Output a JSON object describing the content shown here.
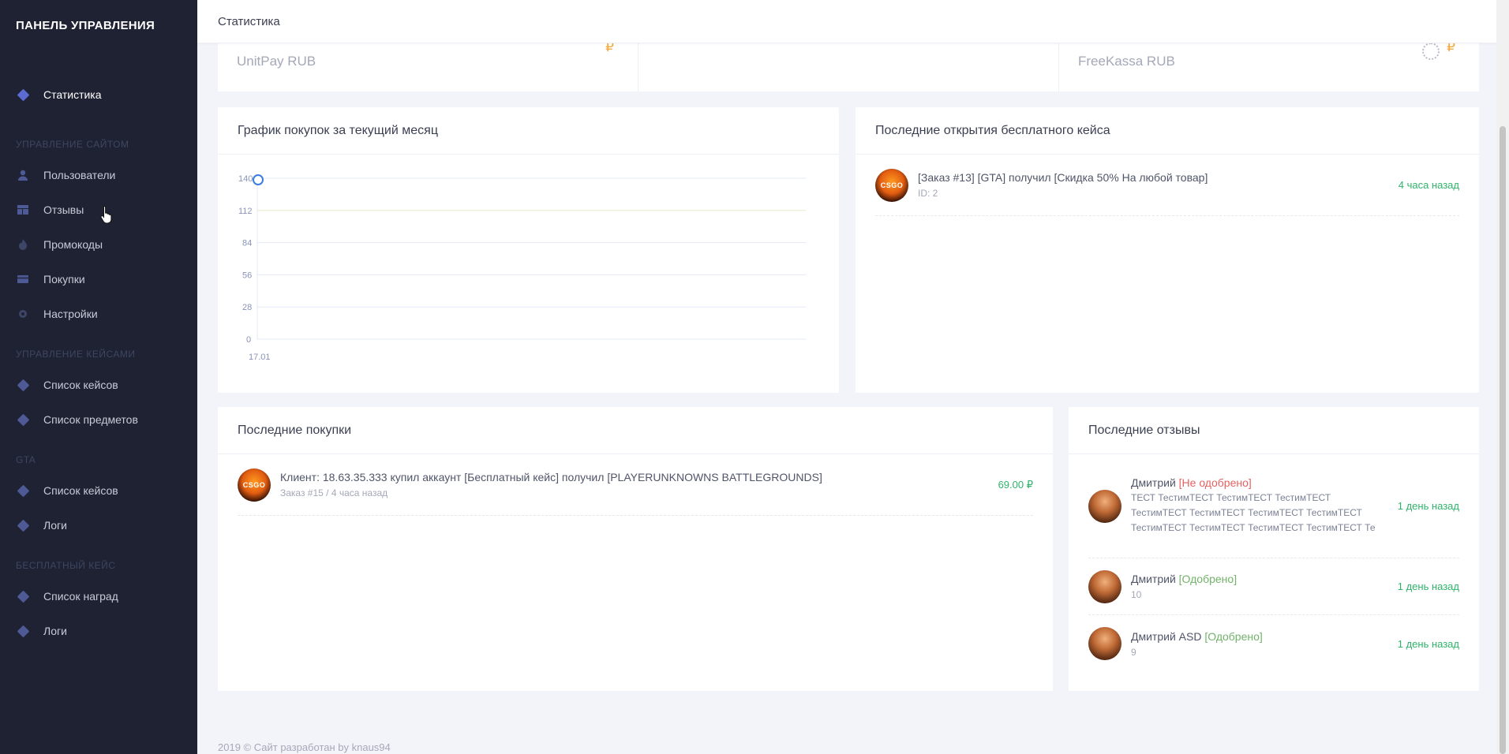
{
  "sidebar": {
    "brand": "ПАНЕЛЬ УПРАВЛЕНИЯ",
    "top_item": "Статистика",
    "sections": [
      {
        "title": "УПРАВЛЕНИЕ САЙТОМ",
        "items": [
          "Пользователи",
          "Отзывы",
          "Промокоды",
          "Покупки",
          "Настройки"
        ]
      },
      {
        "title": "УПРАВЛЕНИЕ КЕЙСАМИ",
        "items": [
          "Список кейсов",
          "Список предметов"
        ]
      },
      {
        "title": "GTA",
        "items": [
          "Список кейсов",
          "Логи"
        ]
      },
      {
        "title": "БЕСПЛАТНЫЙ КЕЙС",
        "items": [
          "Список наград",
          "Логи"
        ]
      }
    ]
  },
  "header": {
    "title": "Статистика"
  },
  "stats": [
    {
      "label": "UnitPay RUB",
      "currency": "₽"
    },
    {
      "label": "",
      "currency": ""
    },
    {
      "label": "FreeKassa RUB",
      "currency": "₽"
    }
  ],
  "chart_card": {
    "title": "График покупок за текущий месяц"
  },
  "chart_data": {
    "type": "line",
    "x": [
      "17.01"
    ],
    "values": [
      140
    ],
    "yticks": [
      140,
      112,
      84,
      56,
      28,
      0
    ],
    "ylim": [
      0,
      140
    ],
    "grid": true,
    "colors": {
      "line": "#3b7ddd"
    }
  },
  "free_case": {
    "title": "Последние открытия бесплатного кейса",
    "items": [
      {
        "text": "[Заказ #13] [GTA] получил [Скидка 50% На любой товар]",
        "sub": "ID: 2",
        "time": "4 часа назад",
        "avatar_text": "CSGO"
      }
    ]
  },
  "purchases": {
    "title": "Последние покупки",
    "items": [
      {
        "text": "Клиент: 18.63.35.333 купил аккаунт [Бесплатный кейс] получил [PLAYERUNKNOWNS BATTLEGROUNDS]",
        "sub": "Заказ #15 / 4 часа назад",
        "amount": "69.00 ₽",
        "avatar_text": "CSGO"
      }
    ]
  },
  "reviews": {
    "title": "Последние отзывы",
    "items": [
      {
        "name": "Дмитрий",
        "status": "[Не одобрено]",
        "status_type": "no",
        "text": "ТЕСТ ТестимТЕСТ ТестимТЕСТ ТестимТЕСТ ТестимТЕСТ ТестимТЕСТ ТестимТЕСТ ТестимТЕСТ ТестимТЕСТ ТестимТЕСТ ТестимТЕСТ ТестимТЕСТ Те",
        "time": "1 день назад"
      },
      {
        "name": "Дмитрий",
        "status": "[Одобрено]",
        "status_type": "ok",
        "text": "10",
        "time": "1 день назад"
      },
      {
        "name": "Дмитрий ASD",
        "status": "[Одобрено]",
        "status_type": "ok",
        "text": "9",
        "time": "1 день назад"
      }
    ]
  },
  "footer": {
    "text": "2019 © Сайт разработан by knaus94"
  }
}
